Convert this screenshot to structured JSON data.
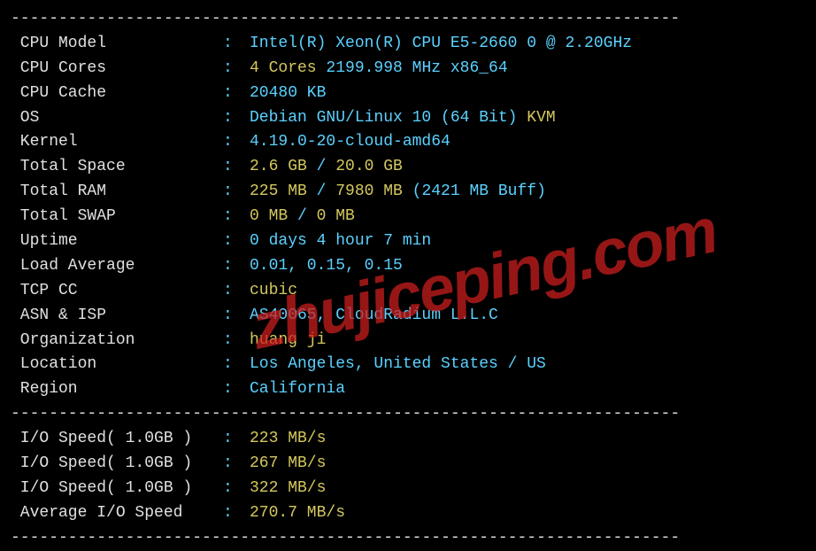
{
  "divider": "----------------------------------------------------------------------",
  "rows": [
    {
      "label": " CPU Model",
      "parts": [
        {
          "cls": "c-cyan",
          "bind": "vals.cpu_model"
        }
      ]
    },
    {
      "label": " CPU Cores",
      "parts": [
        {
          "cls": "c-yellow",
          "bind": "vals.cores"
        },
        {
          "cls": "c-cyan",
          "bind": "vals.cores_suffix"
        }
      ]
    },
    {
      "label": " CPU Cache",
      "parts": [
        {
          "cls": "c-cyan",
          "bind": "vals.cache"
        }
      ]
    },
    {
      "label": " OS",
      "parts": [
        {
          "cls": "c-cyan",
          "bind": "vals.os"
        },
        {
          "cls": "c-yellow",
          "bind": "vals.os_virt"
        }
      ]
    },
    {
      "label": " Kernel",
      "parts": [
        {
          "cls": "c-cyan",
          "bind": "vals.kernel"
        }
      ]
    },
    {
      "label": " Total Space",
      "parts": [
        {
          "cls": "c-yellow",
          "bind": "vals.space_used"
        },
        {
          "cls": "c-cyan",
          "bind": "vals.space_slash"
        },
        {
          "cls": "c-yellow",
          "bind": "vals.space_total"
        }
      ]
    },
    {
      "label": " Total RAM",
      "parts": [
        {
          "cls": "c-yellow",
          "bind": "vals.ram_used"
        },
        {
          "cls": "c-cyan",
          "bind": "vals.ram_slash"
        },
        {
          "cls": "c-yellow",
          "bind": "vals.ram_total"
        },
        {
          "cls": "c-cyan",
          "bind": "vals.ram_buff"
        }
      ]
    },
    {
      "label": " Total SWAP",
      "parts": [
        {
          "cls": "c-yellow",
          "bind": "vals.swap_used"
        },
        {
          "cls": "c-cyan",
          "bind": "vals.swap_slash"
        },
        {
          "cls": "c-yellow",
          "bind": "vals.swap_total"
        }
      ]
    },
    {
      "label": " Uptime",
      "parts": [
        {
          "cls": "c-cyan",
          "bind": "vals.uptime"
        }
      ]
    },
    {
      "label": " Load Average",
      "parts": [
        {
          "cls": "c-cyan",
          "bind": "vals.load"
        }
      ]
    },
    {
      "label": " TCP CC",
      "parts": [
        {
          "cls": "c-yellow",
          "bind": "vals.tcp_cc"
        }
      ]
    },
    {
      "label": " ASN & ISP",
      "parts": [
        {
          "cls": "c-cyan",
          "bind": "vals.asn"
        }
      ]
    },
    {
      "label": " Organization",
      "parts": [
        {
          "cls": "c-yellow",
          "bind": "vals.org"
        }
      ]
    },
    {
      "label": " Location",
      "parts": [
        {
          "cls": "c-cyan",
          "bind": "vals.location"
        }
      ]
    },
    {
      "label": " Region",
      "parts": [
        {
          "cls": "c-cyan",
          "bind": "vals.region"
        }
      ]
    }
  ],
  "io_rows": [
    {
      "label": " I/O Speed( 1.0GB )",
      "parts": [
        {
          "cls": "c-yellow",
          "bind": "vals.io1"
        }
      ]
    },
    {
      "label": " I/O Speed( 1.0GB )",
      "parts": [
        {
          "cls": "c-yellow",
          "bind": "vals.io2"
        }
      ]
    },
    {
      "label": " I/O Speed( 1.0GB )",
      "parts": [
        {
          "cls": "c-yellow",
          "bind": "vals.io3"
        }
      ]
    },
    {
      "label": " Average I/O Speed",
      "parts": [
        {
          "cls": "c-yellow",
          "bind": "vals.io_avg"
        }
      ]
    }
  ],
  "vals": {
    "cpu_model": "Intel(R) Xeon(R) CPU E5-2660 0 @ 2.20GHz",
    "cores": "4 Cores ",
    "cores_suffix": "2199.998 MHz x86_64",
    "cache": "20480 KB",
    "os": "Debian GNU/Linux 10 (64 Bit) ",
    "os_virt": "KVM",
    "kernel": "4.19.0-20-cloud-amd64",
    "space_used": "2.6 GB ",
    "space_slash": "/ ",
    "space_total": "20.0 GB",
    "ram_used": "225 MB ",
    "ram_slash": "/ ",
    "ram_total": "7980 MB ",
    "ram_buff": "(2421 MB Buff)",
    "swap_used": "0 MB ",
    "swap_slash": "/ ",
    "swap_total": "0 MB",
    "uptime": "0 days 4 hour 7 min",
    "load": "0.01, 0.15, 0.15",
    "tcp_cc": "cubic",
    "asn": "AS40065, CloudRadium L.L.C",
    "org": "huang ji",
    "location": "Los Angeles, United States / US",
    "region": "California",
    "io1": "223 MB/s",
    "io2": "267 MB/s",
    "io3": "322 MB/s",
    "io_avg": "270.7 MB/s"
  },
  "watermark": "zhujiceping.com",
  "colon": ": "
}
